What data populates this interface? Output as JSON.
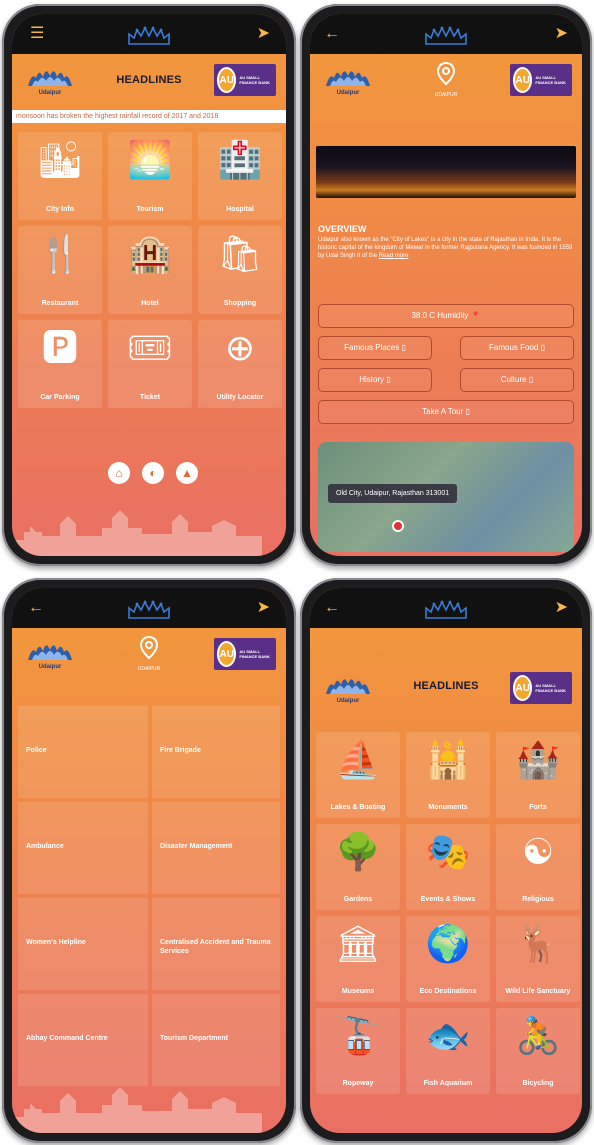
{
  "phone1": {
    "headlines": "HEADLINES",
    "ticker": "monsoon has broken the highest rainfall record of 2017 and 2018",
    "tiles": [
      {
        "label": "City Info",
        "icon": "city-info-icon"
      },
      {
        "label": "Tourism",
        "icon": "tourism-icon"
      },
      {
        "label": "Hospital",
        "icon": "hospital-icon"
      },
      {
        "label": "Restaurant",
        "icon": "restaurant-icon"
      },
      {
        "label": "Hotel",
        "icon": "hotel-icon"
      },
      {
        "label": "Shopping",
        "icon": "shopping-icon"
      },
      {
        "label": "Car Parking",
        "icon": "car-parking-icon"
      },
      {
        "label": "Ticket",
        "icon": "ticket-icon"
      },
      {
        "label": "Utility Locator",
        "icon": "utility-locator-icon"
      }
    ]
  },
  "phone2": {
    "pin_label": "UDAIPUR",
    "overview_title": "OVERVIEW",
    "overview_text": "Udaipur also known as the \"City of Lakes\" is a city in the state of Rajasthan in India. It is the historic capital of the kingdom of Mewar in the former Rajputana Agency. It was founded in 1559 by Udai Singh II of the",
    "read_more": "Read more",
    "weather": "38.0 C Humidity",
    "buttons": [
      "Famous Places",
      "Famous Food",
      "History",
      "Culture",
      "Take A Tour"
    ],
    "map_address": "Old City, Udaipur, Rajasthan 313001"
  },
  "phone3": {
    "pin_label": "UDAIPUR",
    "items": [
      "Police",
      "Fire Brigade",
      "Ambulance",
      "Disaster Management",
      "Women's Helpline",
      "Centralised Accident and Trauma Services",
      "Abhay Command Centre",
      "Tourism Department"
    ]
  },
  "phone4": {
    "headlines": "HEADLINES",
    "tiles": [
      {
        "label": "Lakes & Boating",
        "icon": "lake-icon"
      },
      {
        "label": "Monuments",
        "icon": "monument-icon"
      },
      {
        "label": "Forts",
        "icon": "fort-icon"
      },
      {
        "label": "Gardens",
        "icon": "garden-icon"
      },
      {
        "label": "Events & Shows",
        "icon": "theatre-icon"
      },
      {
        "label": "Religious",
        "icon": "religious-icon"
      },
      {
        "label": "Museums",
        "icon": "museum-icon"
      },
      {
        "label": "Eco Destinations",
        "icon": "eco-icon"
      },
      {
        "label": "Wild Life Sanctuary",
        "icon": "deer-icon"
      },
      {
        "label": "Ropeway",
        "icon": "ropeway-icon"
      },
      {
        "label": "Fish Aquarium",
        "icon": "aquarium-icon"
      },
      {
        "label": "Bicycling",
        "icon": "bicycle-icon"
      }
    ]
  },
  "brand": {
    "logo_sub": "Udaipur",
    "au_letters": "AU",
    "au_text": "AU SMALL FINANCE BANK"
  },
  "colors": {
    "accent": "#f29a3c",
    "au_purple": "#5a2f87",
    "au_gold": "#f4a72a"
  }
}
